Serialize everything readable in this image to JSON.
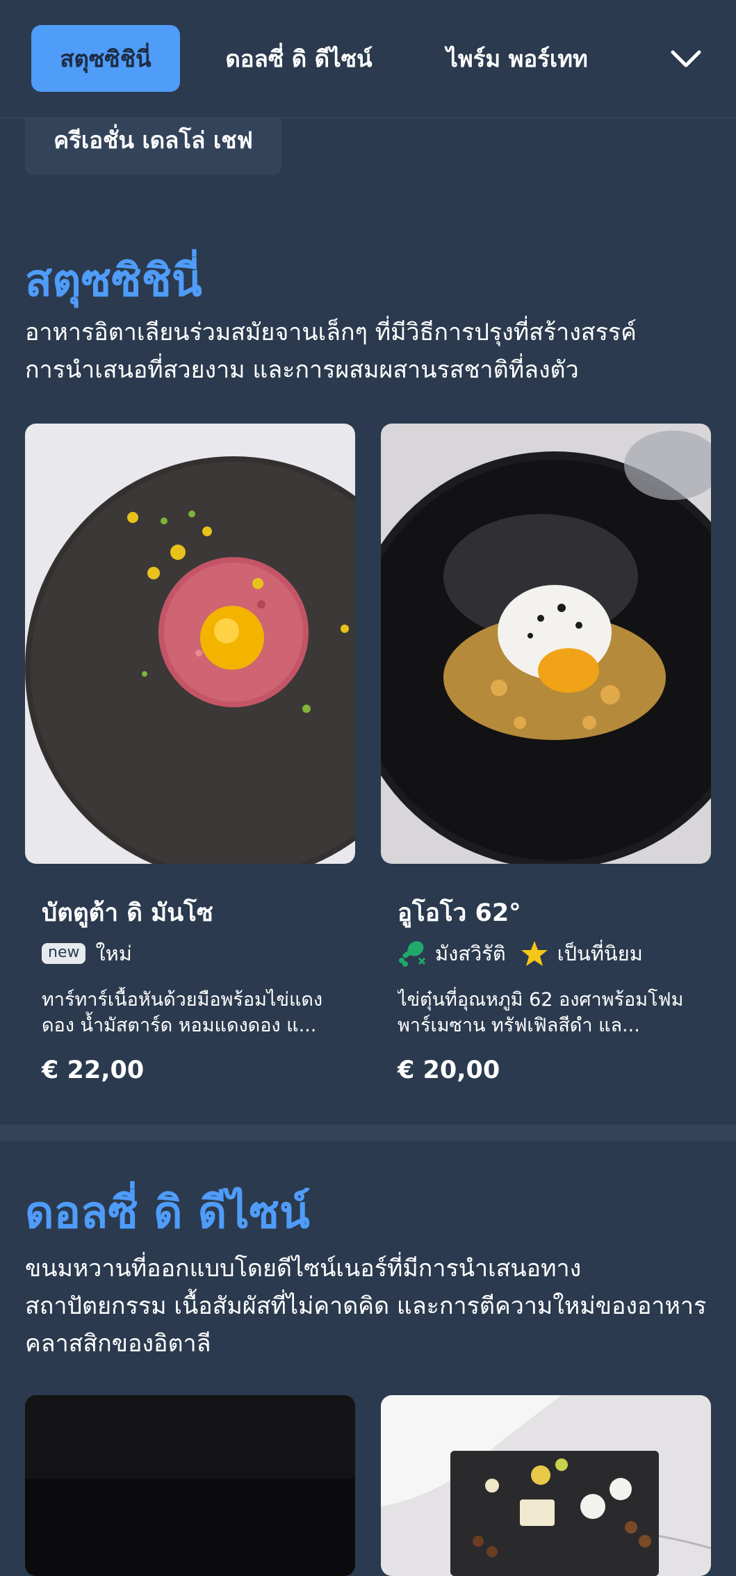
{
  "tabs": [
    {
      "label": "สตุซซิชินี่",
      "active": true
    },
    {
      "label": "ดอลซี่ ดิ ดีไซน์",
      "active": false
    },
    {
      "label": "ไพร์ม พอร์เทท",
      "active": false
    },
    {
      "label": "ครีเอชั่น เดลโล่ เชฟ",
      "active": false
    }
  ],
  "sections": [
    {
      "title": "สตุซซิชินี่",
      "description": "อาหารอิตาเลียนร่วมสมัยจานเล็กๆ ที่มีวิธีการปรุงที่สร้างสรรค์ การนำเสนอที่สวยงาม และการผสมผสานรสชาติที่ลงตัว",
      "items": [
        {
          "name": "บัตตูต้า ดิ มันโซ",
          "badge": "new",
          "tag": "ใหม่",
          "description": "ทาร์ทาร์เนื้อหันด้วยมือพร้อมไข่แดงดอง น้ำมัสตาร์ด หอมแดงดอง แ...",
          "price": "€ 22,00",
          "image_icon": "beef-tartare-image"
        },
        {
          "name": "อูโอโว 62°",
          "tag_vegetarian": "มังสวิรัติ",
          "tag_popular": "เป็นที่นิยม",
          "description": "ไข่ตุ๋นที่อุณหภูมิ 62 องศาพร้อมโฟมพาร์เมซาน ทรัฟเฟิลสีดำ แล...",
          "price": "€ 20,00",
          "image_icon": "poached-egg-image"
        }
      ]
    },
    {
      "title": "ดอลซี่ ดิ ดีไซน์",
      "description": "ขนมหวานที่ออกแบบโดยดีไซน์เนอร์ที่มีการนำเสนอทางสถาปัตยกรรม เนื้อสัมผัสที่ไม่คาดคิด และการตีความใหม่ของอาหารคลาสสิกของอิตาลี"
    }
  ],
  "colors": {
    "background": "#2b3a4e",
    "accent": "#4f9cf9",
    "vegetarian": "#1faa6b",
    "star": "#f5c518"
  }
}
